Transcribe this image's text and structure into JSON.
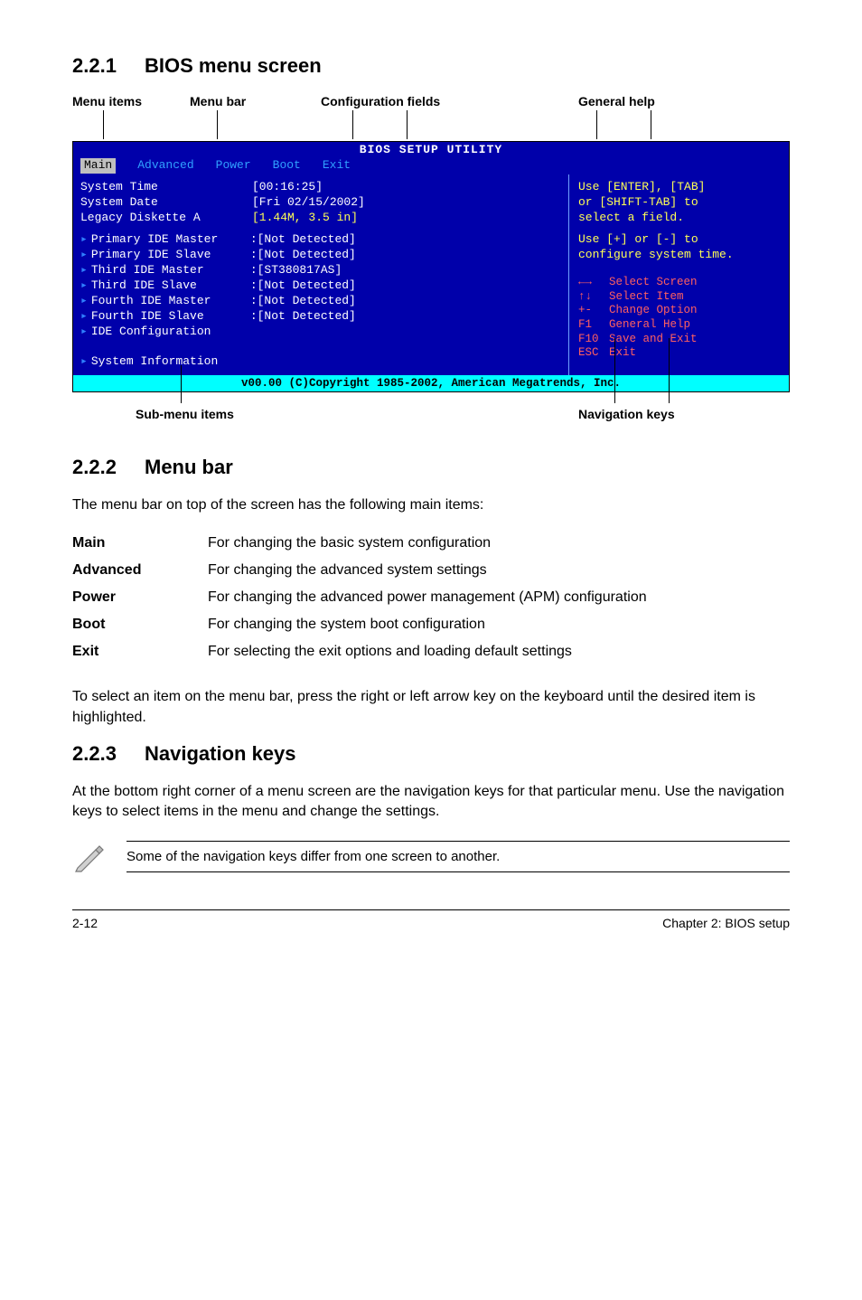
{
  "sections": {
    "s221": {
      "num": "2.2.1",
      "title": "BIOS menu screen"
    },
    "s222": {
      "num": "2.2.2",
      "title": "Menu bar"
    },
    "s223": {
      "num": "2.2.3",
      "title": "Navigation keys"
    }
  },
  "top_labels": {
    "menu_items": "Menu items",
    "menu_bar": "Menu bar",
    "config_fields": "Configuration fields",
    "general_help": "General help"
  },
  "bios": {
    "title": "BIOS SETUP UTILITY",
    "menubar": [
      "Main",
      "Advanced",
      "Power",
      "Boot",
      "Exit"
    ],
    "left_rows": [
      {
        "label": "System Time",
        "value": "[00:16:25]",
        "arrow": false
      },
      {
        "label": "System Date",
        "value": "[Fri 02/15/2002]",
        "arrow": false
      },
      {
        "label": "Legacy Diskette A",
        "value": "[1.44M, 3.5 in]",
        "arrow": false,
        "valcolor": "yellow"
      }
    ],
    "left_rows2": [
      {
        "label": "Primary IDE Master",
        "value": ":[Not Detected]",
        "arrow": true
      },
      {
        "label": "Primary IDE Slave",
        "value": ":[Not Detected]",
        "arrow": true
      },
      {
        "label": "Third IDE Master",
        "value": ":[ST380817AS]",
        "arrow": true
      },
      {
        "label": "Third IDE Slave",
        "value": ":[Not Detected]",
        "arrow": true
      },
      {
        "label": "Fourth IDE Master",
        "value": ":[Not Detected]",
        "arrow": true
      },
      {
        "label": "Fourth IDE Slave",
        "value": ":[Not Detected]",
        "arrow": true
      },
      {
        "label": "IDE Configuration",
        "value": "",
        "arrow": true
      }
    ],
    "left_rows3": [
      {
        "label": "System Information",
        "value": "",
        "arrow": true
      }
    ],
    "help_top": [
      "Use [ENTER], [TAB]",
      "or [SHIFT-TAB] to",
      "select a field."
    ],
    "help_mid": [
      "Use [+] or [-] to",
      "configure system time."
    ],
    "help_keys": [
      {
        "k": "←→",
        "v": "Select Screen"
      },
      {
        "k": "↑↓",
        "v": "Select Item"
      },
      {
        "k": "+-",
        "v": "Change Option"
      },
      {
        "k": "F1",
        "v": "General Help"
      },
      {
        "k": "F10",
        "v": "Save and Exit"
      },
      {
        "k": "ESC",
        "v": "Exit"
      }
    ],
    "footer": "v00.00 (C)Copyright 1985-2002, American Megatrends, Inc."
  },
  "below_labels": {
    "submenu": "Sub-menu items",
    "navkeys": "Navigation keys"
  },
  "s222_intro": "The menu bar on top of the screen has the following main items:",
  "def_rows": [
    {
      "term": "Main",
      "desc": "For changing the basic system configuration"
    },
    {
      "term": "Advanced",
      "desc": "For changing the advanced system settings"
    },
    {
      "term": "Power",
      "desc": "For changing the advanced power management (APM) configuration"
    },
    {
      "term": "Boot",
      "desc": "For changing the system boot configuration"
    },
    {
      "term": "Exit",
      "desc": "For selecting the exit options and loading default settings"
    }
  ],
  "s222_after": "To select an item on the menu bar, press the right or left arrow key on the keyboard until the desired item is highlighted.",
  "s223_body": "At the bottom right corner of a menu screen are the navigation keys for that particular menu. Use the navigation keys to select items in the menu and change the settings.",
  "note_text": "Some of the navigation keys differ from one screen to another.",
  "footer": {
    "left": "2-12",
    "right": "Chapter 2: BIOS setup"
  }
}
